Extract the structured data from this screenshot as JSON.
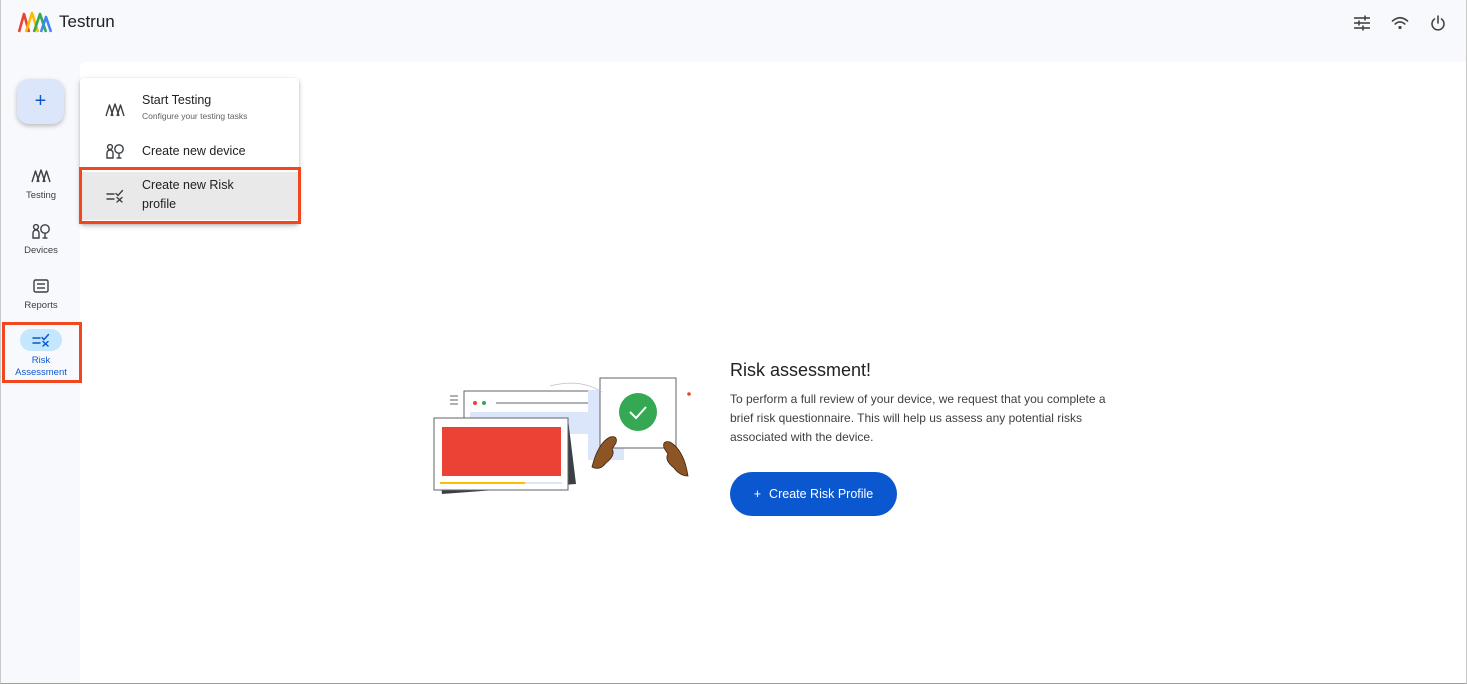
{
  "app": {
    "title": "Testrun"
  },
  "topbar": {
    "icons": [
      "tune-icon",
      "wifi-icon",
      "power-icon"
    ]
  },
  "fab": {
    "label": "+"
  },
  "rail": {
    "items": [
      {
        "label": "Testing",
        "icon": "testing-icon"
      },
      {
        "label": "Devices",
        "icon": "devices-icon"
      },
      {
        "label": "Reports",
        "icon": "reports-icon"
      },
      {
        "label": "Risk\nAssessment",
        "label_line1": "Risk",
        "label_line2": "Assessment",
        "icon": "risk-icon",
        "active": true
      }
    ]
  },
  "menu": {
    "items": [
      {
        "label": "Start Testing",
        "sub": "Configure your testing tasks",
        "icon": "testing-icon"
      },
      {
        "label": "Create new device",
        "icon": "devices-icon"
      },
      {
        "label_line1": "Create new Risk",
        "label_line2": "profile",
        "icon": "risk-icon",
        "highlighted": true
      }
    ]
  },
  "content": {
    "title": "Risk assessment!",
    "description": "To perform a full review of your device, we request that you complete a brief risk questionnaire. This will help us assess any potential risks associated with the device.",
    "cta_label": "Create Risk Profile",
    "cta_icon": "+"
  },
  "colors": {
    "accent": "#0b57d0",
    "highlight_border": "#f0471f",
    "active_pill": "#c2e7ff"
  }
}
